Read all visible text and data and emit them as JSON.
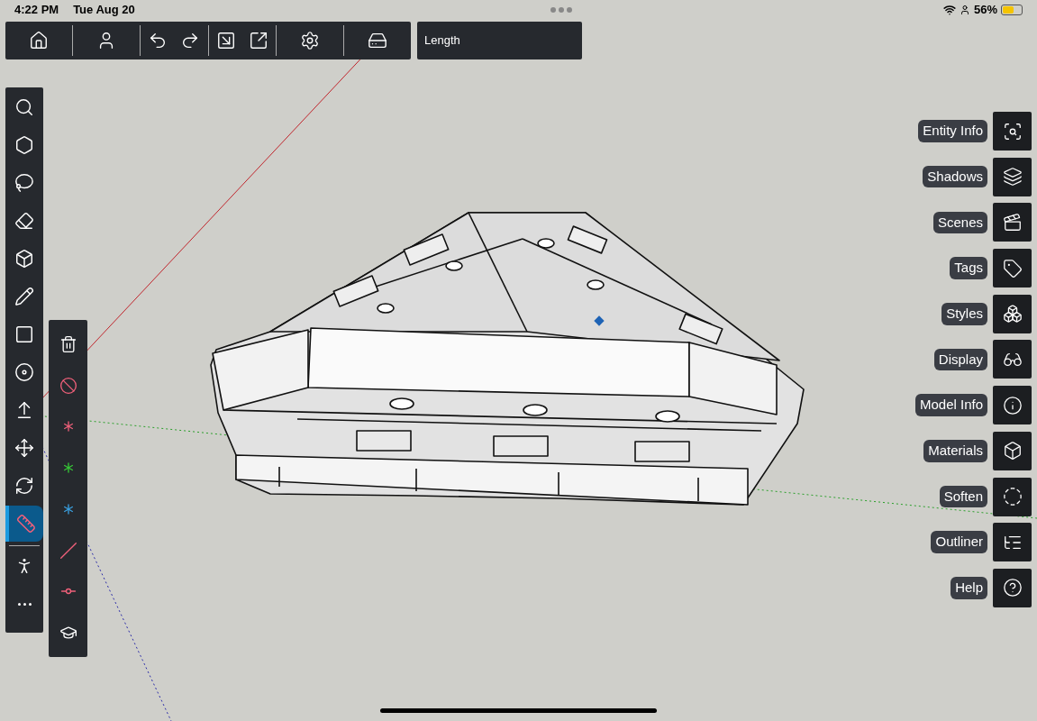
{
  "status_bar": {
    "time": "4:22 PM",
    "date": "Tue Aug 20",
    "battery": "56%"
  },
  "top_toolbar": {
    "groups": [
      [
        {
          "kind": "home"
        }
      ],
      [
        {
          "kind": "account"
        }
      ],
      [
        {
          "kind": "undo"
        },
        {
          "kind": "redo"
        }
      ],
      [
        {
          "kind": "import"
        },
        {
          "kind": "export"
        }
      ],
      [
        {
          "kind": "settings"
        }
      ],
      [
        {
          "kind": "tray"
        }
      ]
    ]
  },
  "measurement": {
    "label": "Length"
  },
  "left_toolbar": {
    "items": [
      {
        "kind": "search",
        "selected": false
      },
      {
        "kind": "component",
        "selected": false
      },
      {
        "kind": "lasso",
        "selected": false
      },
      {
        "kind": "eraser",
        "selected": false
      },
      {
        "kind": "box",
        "selected": false
      },
      {
        "kind": "pencil",
        "selected": false
      },
      {
        "kind": "rectangle",
        "selected": false
      },
      {
        "kind": "circle",
        "selected": false
      },
      {
        "kind": "pushpull",
        "selected": false
      },
      {
        "kind": "move",
        "selected": false
      },
      {
        "kind": "rotate",
        "selected": false
      },
      {
        "kind": "tape",
        "selected": true
      },
      {
        "kind": "walk",
        "selected": false
      },
      {
        "kind": "more",
        "selected": false
      }
    ]
  },
  "tape_options": {
    "items": [
      {
        "kind": "delete-guides"
      },
      {
        "kind": "hide-guides"
      },
      {
        "kind": "lock-red"
      },
      {
        "kind": "lock-green"
      },
      {
        "kind": "lock-blue"
      },
      {
        "kind": "lock-parallel"
      },
      {
        "kind": "endpoint"
      },
      {
        "kind": "tutorial"
      }
    ]
  },
  "panels": [
    {
      "label": "Entity Info",
      "kind": "entity"
    },
    {
      "label": "Shadows",
      "kind": "shadows"
    },
    {
      "label": "Scenes",
      "kind": "scenes"
    },
    {
      "label": "Tags",
      "kind": "tags"
    },
    {
      "label": "Styles",
      "kind": "styles"
    },
    {
      "label": "Display",
      "kind": "display"
    },
    {
      "label": "Model Info",
      "kind": "info"
    },
    {
      "label": "Materials",
      "kind": "materials"
    },
    {
      "label": "Soften",
      "kind": "soften"
    },
    {
      "label": "Outliner",
      "kind": "outliner"
    },
    {
      "label": "Help",
      "kind": "help"
    }
  ]
}
